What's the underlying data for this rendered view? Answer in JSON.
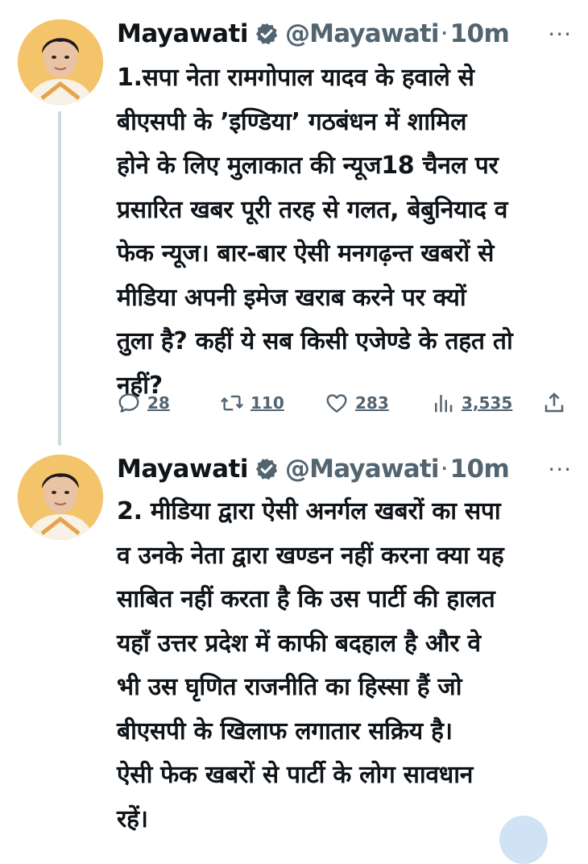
{
  "tweets": [
    {
      "author_name": "Mayawati",
      "handle": "@Mayawati",
      "separator": "·",
      "time": "10m",
      "more": "···",
      "text": "1.सपा नेता रामगोपाल यादव के हवाले से\nबीएसपी के ’इण्डिया’ गठबंधन में शामिल\nहोने के लिए मुलाकात की न्यूज18 चैनल पर\nप्रसारित खबर पूरी तरह से गलत, बेबुनियाद व\nफेक न्यूज। बार-बार ऐसी मनगढ़न्त खबरों से\nमीडिया अपनी इमेज खराब करने पर क्यों\nतुला है? कहीं ये सब किसी एजेण्डे के तहत तो\nनहीं?",
      "stats": {
        "replies": "28",
        "reposts": "110",
        "likes": "283",
        "views": "3,535"
      }
    },
    {
      "author_name": "Mayawati",
      "handle": "@Mayawati",
      "separator": "·",
      "time": "10m",
      "more": "···",
      "text": "2. मीडिया द्वारा ऐसी अनर्गल खबरों का सपा\nव उनके नेता द्वारा खण्डन नहीं करना क्या यह\nसाबित नहीं करता है कि उस पार्टी की हालत\nयहाँ उत्तर प्रदेश में काफी बदहाल है और वे\nभी उस घृणित राजनीति का हिस्सा हैं जो\nबीएसपी के खिलाफ लगातार सक्रिय है।\nऐसी फेक खबरों से पार्टी के लोग सावधान\nरहें।"
    }
  ],
  "icons": {
    "verified": "verified-badge-icon",
    "reply": "reply-icon",
    "repost": "repost-icon",
    "like": "heart-icon",
    "views": "views-icon",
    "share": "share-icon"
  },
  "colors": {
    "text": "#0f1419",
    "secondary": "#536471",
    "verified_bg": "#536471",
    "thread_line": "#cfd9de"
  }
}
